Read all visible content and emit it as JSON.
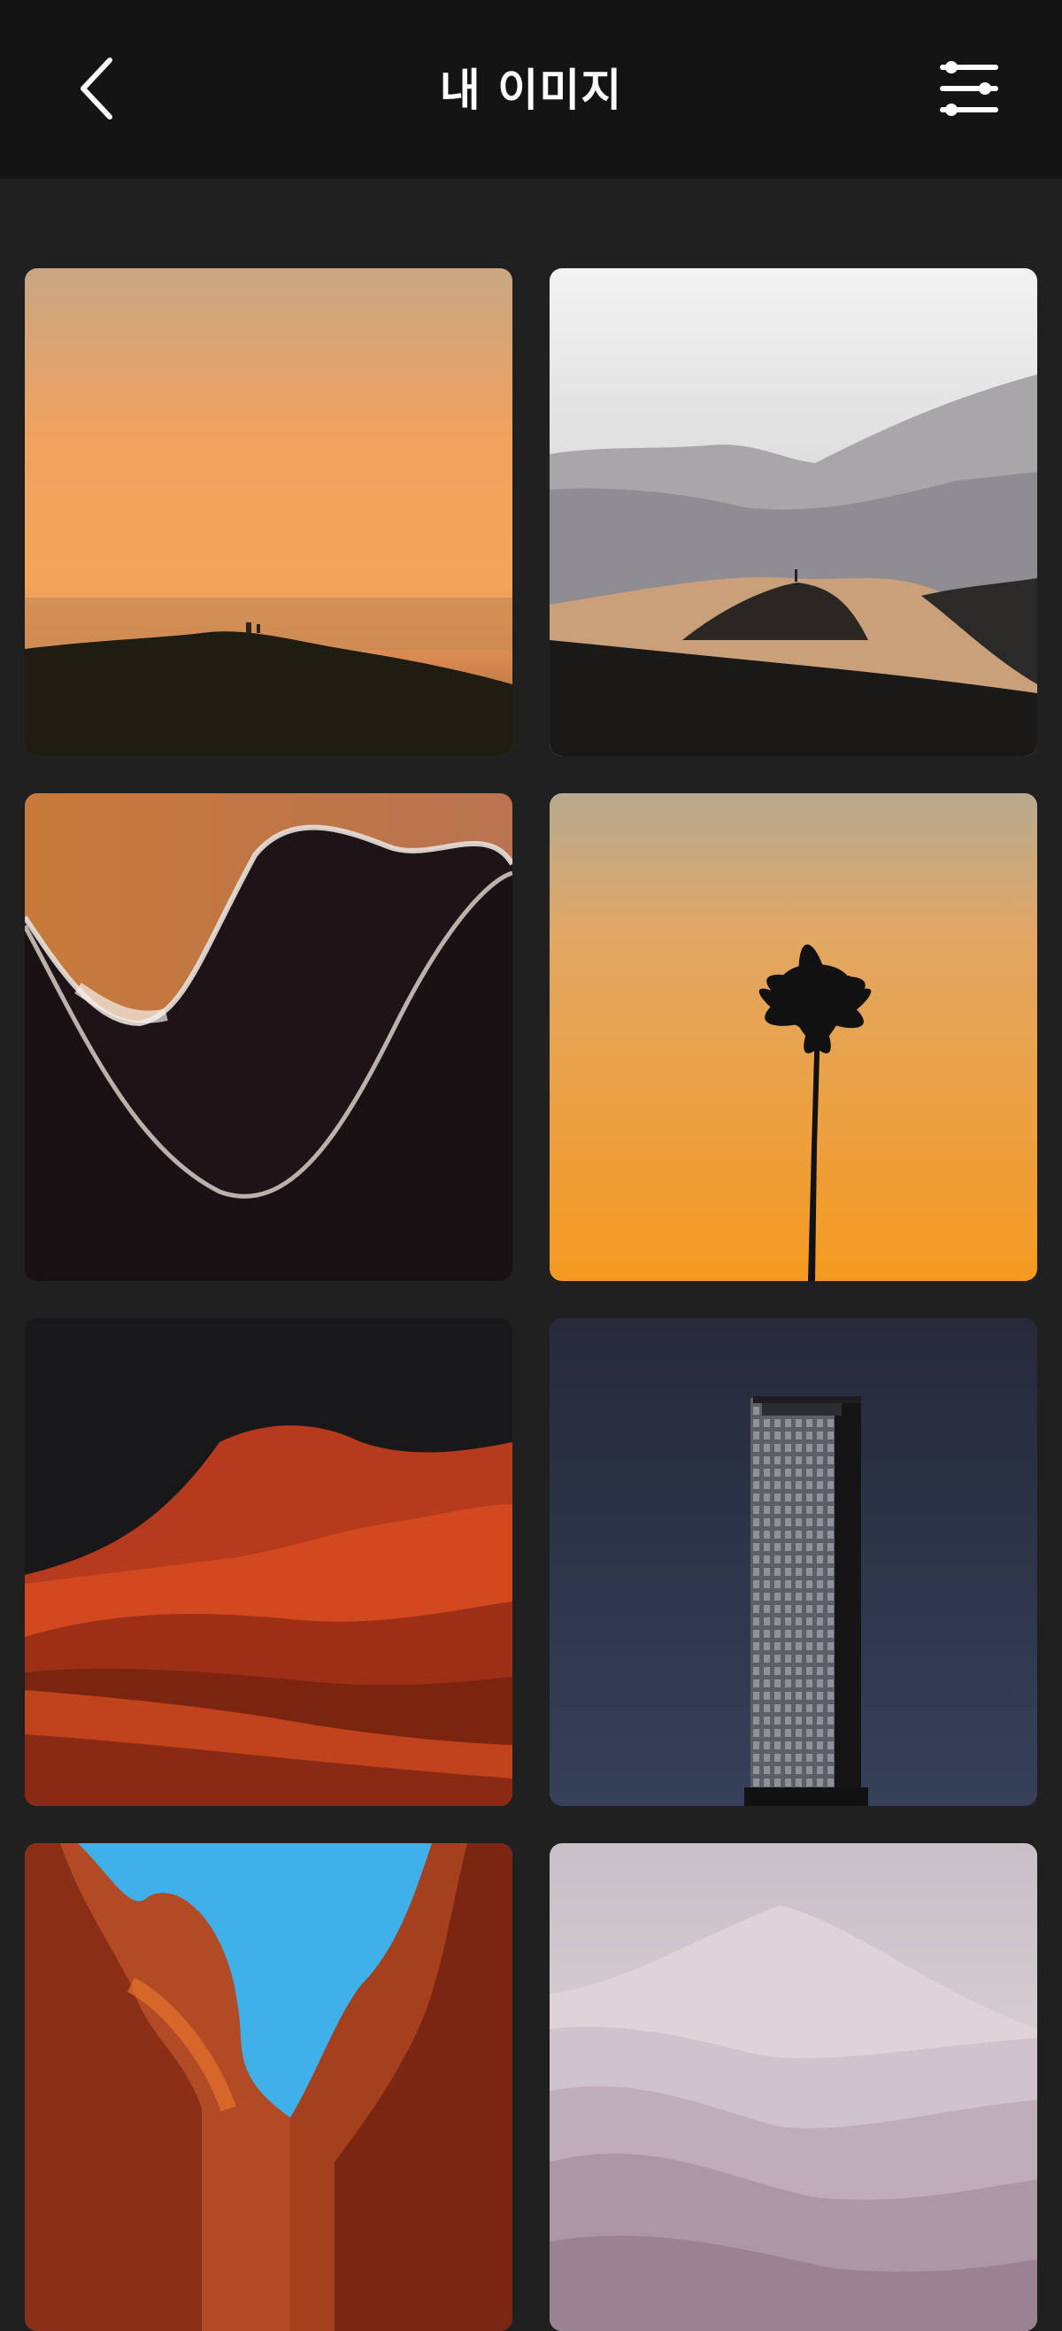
{
  "header": {
    "title": "내 이미지",
    "back_icon": "chevron-left-icon",
    "filter_icon": "sliders-icon"
  },
  "colors": {
    "header_bg": "#141414",
    "page_bg": "#202020"
  },
  "gallery": {
    "images": [
      {
        "name": "sunset-sea-image"
      },
      {
        "name": "desert-dune-image"
      },
      {
        "name": "abstract-wave-image"
      },
      {
        "name": "palm-tree-image"
      },
      {
        "name": "red-dunes-image"
      },
      {
        "name": "skyscraper-image"
      },
      {
        "name": "red-canyon-image"
      },
      {
        "name": "misty-mountains-image"
      }
    ]
  }
}
